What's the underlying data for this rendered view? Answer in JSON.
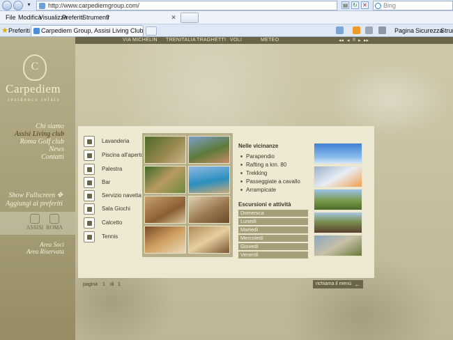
{
  "browser": {
    "url": "http://www.carpediemgroup.com/",
    "search_placeholder": "Bing",
    "menu": [
      "File",
      "Modifica",
      "Visualizza",
      "Preferiti",
      "Strumenti",
      "?"
    ],
    "favorites_label": "Preferiti",
    "tab_title": "Carpediem Group, Assisi Living Club, Roma Golf Club, ...",
    "commands": [
      "Pagina",
      "Sicurezza",
      "Strumenti"
    ]
  },
  "site": {
    "top_nav": [
      "VIA MICHELIN",
      "TRENITALIA",
      "TRAGHETTI",
      "VOLI",
      "METEO"
    ],
    "top_controls": [
      "◂◂",
      "◂",
      "II",
      "▸",
      "▸▸"
    ],
    "logo": {
      "monogram": "C",
      "name": "Carpediem",
      "subtitle": "residence relais"
    },
    "side_nav": [
      "Chi siamo",
      "Assisi Living club",
      "Roma Golf club",
      "News",
      "Contatti"
    ],
    "fullscreen": "Show Fullscreen",
    "favorites": "Aggiungi ai preferiti",
    "partners": [
      "ASSISI",
      "ROMA"
    ],
    "areas": [
      "Area Soci",
      "Area Riservata"
    ],
    "amenities": [
      "Lavanderia",
      "Piscina all'aperto",
      "Palestra",
      "Bar",
      "Servizio navetta",
      "Sala Giochi",
      "Calcetto",
      "Tennis"
    ],
    "nearby_title": "Nelle vicinanze",
    "nearby": [
      "Parapendio",
      "Rafting a km. 80",
      "Trekking",
      "Passeggiate a cavallo",
      "Arrampicate"
    ],
    "excursions_title": "Escursioni e attività",
    "days": [
      "Domenica",
      "Lunedì",
      "Martedì",
      "Mercoledì",
      "Giovedì",
      "Venerdì"
    ],
    "pager": {
      "label": "pagina",
      "current": "1",
      "of": "di",
      "total": "1"
    },
    "back_menu": "richiama il menù"
  }
}
